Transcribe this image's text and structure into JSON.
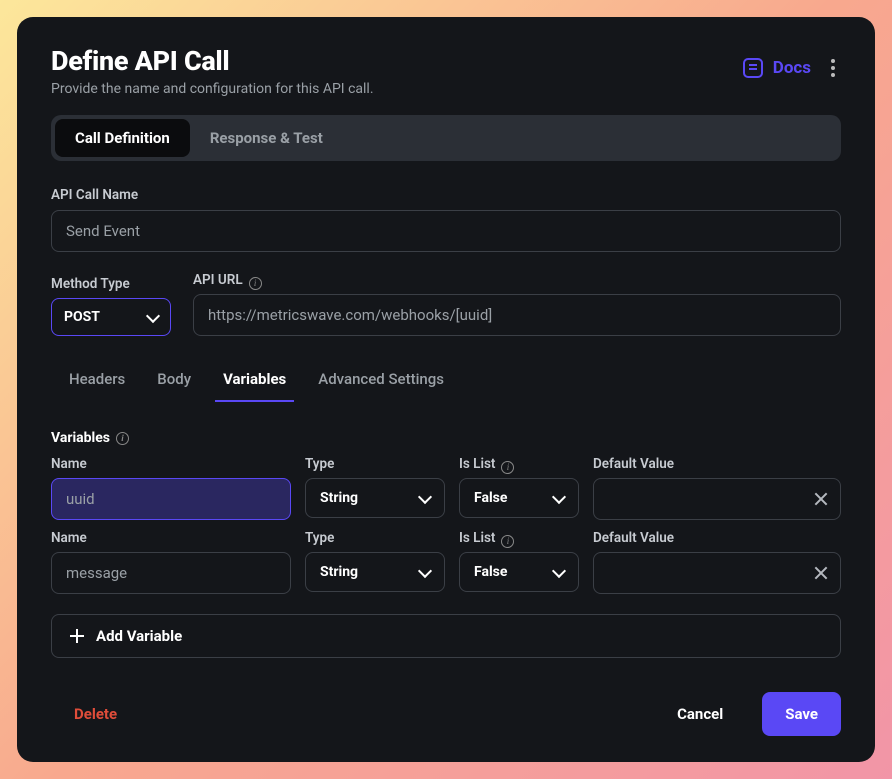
{
  "header": {
    "title": "Define API Call",
    "subtitle": "Provide the name and configuration for this API call.",
    "docs_label": "Docs"
  },
  "segments": {
    "call_definition": "Call Definition",
    "response_test": "Response & Test"
  },
  "fields": {
    "api_call_name_label": "API Call Name",
    "api_call_name_value": "Send Event",
    "method_type_label": "Method Type",
    "method_type_value": "POST",
    "api_url_label": "API URL",
    "api_url_value": "https://metricswave.com/webhooks/[uuid]"
  },
  "subtabs": [
    "Headers",
    "Body",
    "Variables",
    "Advanced Settings"
  ],
  "variables_section": {
    "title": "Variables",
    "columns": {
      "name": "Name",
      "type": "Type",
      "is_list": "Is List",
      "default": "Default Value"
    },
    "rows": [
      {
        "name": "uuid",
        "type": "String",
        "is_list": "False",
        "default": ""
      },
      {
        "name": "message",
        "type": "String",
        "is_list": "False",
        "default": ""
      }
    ],
    "add_label": "Add Variable"
  },
  "footer": {
    "delete": "Delete",
    "cancel": "Cancel",
    "save": "Save"
  }
}
